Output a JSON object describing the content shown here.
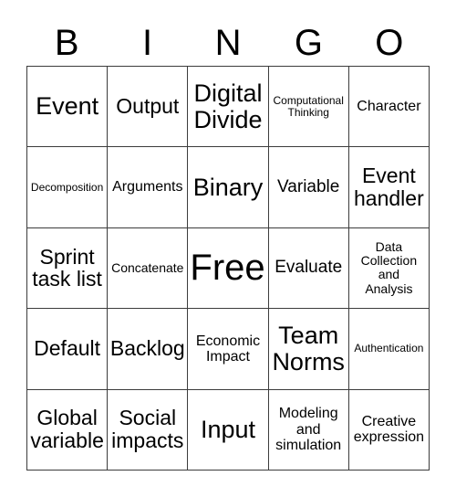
{
  "card": {
    "title": "BINGO",
    "header_letters": [
      "B",
      "I",
      "N",
      "G",
      "O"
    ],
    "free_space_label": "Free!",
    "border_color": "#3c3c3c",
    "background_color": "#ffffff",
    "text_color": "#000000",
    "rows": 5,
    "columns": 5
  },
  "cells": [
    {
      "text": "Event",
      "size": "sz-lg"
    },
    {
      "text": "Output",
      "size": "sz-md"
    },
    {
      "text": "Digital\nDivide",
      "size": "sz-lg"
    },
    {
      "text": "Computational\nThinking",
      "size": "sz-tiny"
    },
    {
      "text": "Character",
      "size": "sz-xs"
    },
    {
      "text": "Decomposition",
      "size": "sz-tiny"
    },
    {
      "text": "Arguments",
      "size": "sz-xs"
    },
    {
      "text": "Binary",
      "size": "sz-lg"
    },
    {
      "text": "Variable",
      "size": "sz-sm"
    },
    {
      "text": "Event\nhandler",
      "size": "sz-md"
    },
    {
      "text": "Sprint\ntask list",
      "size": "sz-md"
    },
    {
      "text": "Concatenate",
      "size": "sz-xxs"
    },
    {
      "text": "Free!",
      "size": "sz-xl"
    },
    {
      "text": "Evaluate",
      "size": "sz-sm"
    },
    {
      "text": "Data\nCollection\nand\nAnalysis",
      "size": "sz-xxs"
    },
    {
      "text": "Default",
      "size": "sz-md"
    },
    {
      "text": "Backlog",
      "size": "sz-md"
    },
    {
      "text": "Economic\nImpact",
      "size": "sz-xs"
    },
    {
      "text": "Team\nNorms",
      "size": "sz-lg"
    },
    {
      "text": "Authentication",
      "size": "sz-tiny"
    },
    {
      "text": "Global\nvariable",
      "size": "sz-md"
    },
    {
      "text": "Social\nimpacts",
      "size": "sz-md"
    },
    {
      "text": "Input",
      "size": "sz-lg"
    },
    {
      "text": "Modeling\nand\nsimulation",
      "size": "sz-xs"
    },
    {
      "text": "Creative\nexpression",
      "size": "sz-xs"
    }
  ]
}
